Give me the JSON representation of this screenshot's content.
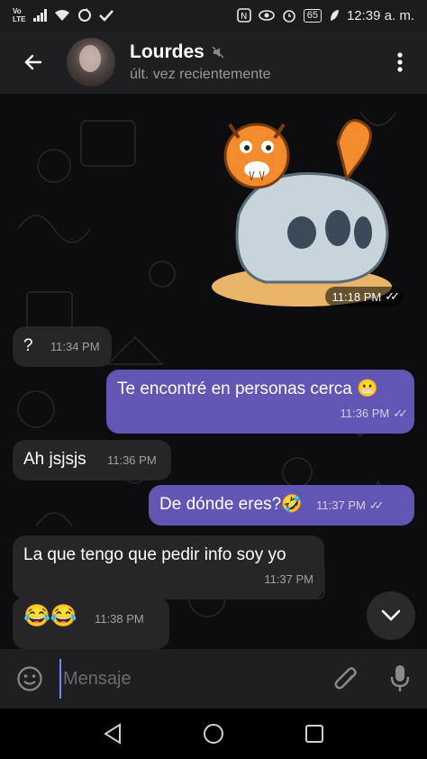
{
  "status_bar": {
    "network": "Vo LTE",
    "battery": "65",
    "time": "12:39 a. m."
  },
  "header": {
    "contact_name": "Lourdes",
    "last_seen": "últ. vez recientemente"
  },
  "messages": [
    {
      "id": "sticker",
      "type": "sticker",
      "direction": "out",
      "time": "11:18 PM",
      "read": true
    },
    {
      "id": "m1",
      "direction": "in",
      "text": "?",
      "time": "11:34 PM"
    },
    {
      "id": "m2",
      "direction": "out",
      "text": "Te encontré en personas cerca 😬",
      "time": "11:36 PM",
      "read": true
    },
    {
      "id": "m3",
      "direction": "in",
      "text": "Ah jsjsjs",
      "time": "11:36 PM"
    },
    {
      "id": "m4",
      "direction": "out",
      "text": "De dónde eres?🤣",
      "time": "11:37 PM",
      "read": true
    },
    {
      "id": "m5",
      "direction": "in",
      "text": "La que tengo que pedir info soy yo",
      "time": "11:37 PM"
    },
    {
      "id": "m6",
      "direction": "in",
      "text": "😂😂",
      "time": "11:38 PM"
    }
  ],
  "composer": {
    "placeholder": "Mensaje"
  },
  "colors": {
    "outgoing_bubble": "#6156b4",
    "incoming_bubble": "#262628",
    "chat_background": "#0d0d0f"
  }
}
